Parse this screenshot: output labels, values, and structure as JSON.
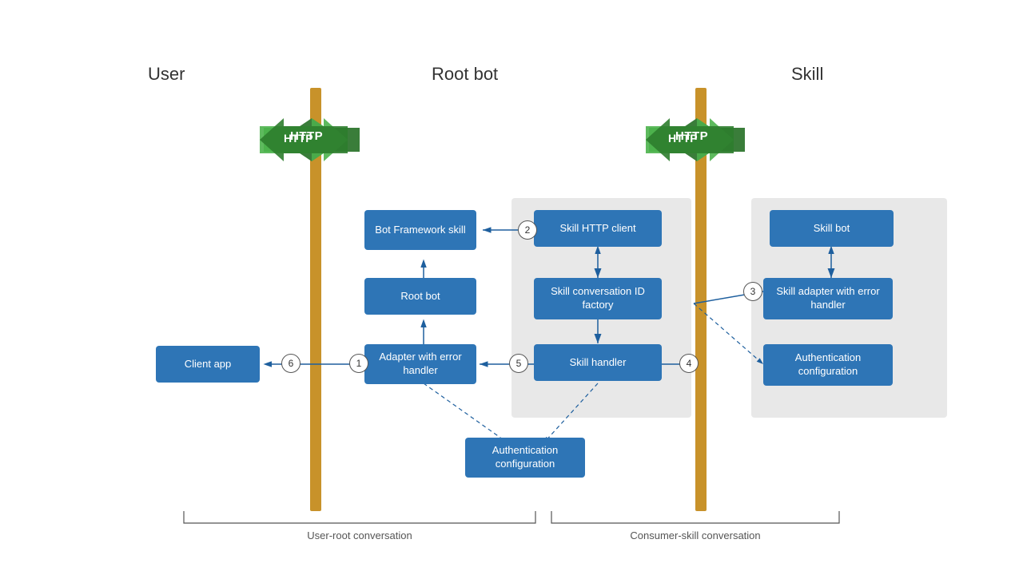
{
  "labels": {
    "user": "User",
    "root_bot": "Root bot",
    "skill": "Skill",
    "http": "HTTP",
    "user_root_conv": "User-root conversation",
    "consumer_skill_conv": "Consumer-skill conversation"
  },
  "boxes": {
    "client_app": "Client app",
    "bot_framework_skill": "Bot Framework skill",
    "root_bot": "Root bot",
    "adapter_with_error_handler": "Adapter with error handler",
    "skill_http_client": "Skill HTTP client",
    "skill_conversation_id_factory": "Skill conversation ID factory",
    "skill_handler": "Skill handler",
    "auth_config_bottom": "Authentication configuration",
    "skill_bot": "Skill bot",
    "skill_adapter_with_error_handler": "Skill adapter with error handler",
    "auth_config_right": "Authentication configuration"
  },
  "numbers": [
    "1",
    "2",
    "3",
    "4",
    "5",
    "6"
  ],
  "colors": {
    "box_blue": "#2e75b6",
    "pillar_orange": "#c8922a",
    "arrow_green": "#3a7d3a",
    "arrow_blue": "#1e5f9e",
    "arrow_dashed": "#1e5f9e"
  }
}
